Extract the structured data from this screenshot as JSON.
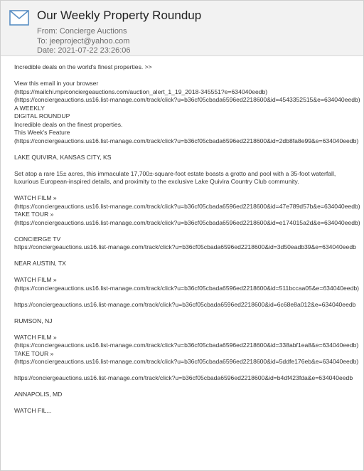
{
  "email": {
    "subject": "Our Weekly Property Roundup",
    "from": "From: Concierge Auctions",
    "to": "To: jeeproject@yahoo.com",
    "date": "Date: 2021-07-22 23:26:06"
  },
  "body": {
    "preheader": "Incredible deals on the world's finest properties. >>",
    "view_browser": "View this email in your browser",
    "view_url": "(https://mailchi.mp/conciergeauctions.com/auction_alert_1_19_2018-345551?e=634040eedb)",
    "track_url_1": "(https://conciergeauctions.us16.list-manage.com/track/click?u=b36cf05cbada6596ed2218600&id=4543352515&e=634040eedb)",
    "a_weekly": "A WEEKLY",
    "digital_roundup": "DIGITAL ROUNDUP",
    "tagline": "Incredible deals on the finest properties.",
    "feature_label": "This Week's Feature",
    "feature_url": "(https://conciergeauctions.us16.list-manage.com/track/click?u=b36cf05cbada6596ed2218600&id=2db8fa8e99&e=634040eedb)",
    "loc1": "LAKE QUIVIRA, KANSAS CITY, KS",
    "desc1": "Set atop a rare 15± acres, this immaculate 17,700±-square-foot estate boasts a grotto and pool with a 35-foot waterfall, luxurious European-inspired details, and proximity to the exclusive Lake Quivira Country Club community.",
    "watch1": "WATCH FILM »",
    "watch1_url": "(https://conciergeauctions.us16.list-manage.com/track/click?u=b36cf05cbada6596ed2218600&id=47e789d57b&e=634040eedb)",
    "tour1": "TAKE TOUR »",
    "tour1_url": "(https://conciergeauctions.us16.list-manage.com/track/click?u=b36cf05cbada6596ed2218600&id=e174015a2d&e=634040eedb)",
    "concierge_tv": "CONCIERGE TV",
    "tv_url": "https://conciergeauctions.us16.list-manage.com/track/click?u=b36cf05cbada6596ed2218600&id=3d50eadb39&e=634040eedb",
    "loc2": "NEAR AUSTIN, TX",
    "watch2": "WATCH FILM »",
    "watch2_url": "(https://conciergeauctions.us16.list-manage.com/track/click?u=b36cf05cbada6596ed2218600&id=511bccaa05&e=634040eedb)",
    "loc2_url": "https://conciergeauctions.us16.list-manage.com/track/click?u=b36cf05cbada6596ed2218600&id=6c68e8a012&e=634040eedb",
    "loc3": "RUMSON, NJ",
    "watch3": "WATCH FILM »",
    "watch3_url": "(https://conciergeauctions.us16.list-manage.com/track/click?u=b36cf05cbada6596ed2218600&id=338abf1ea8&e=634040eedb)",
    "tour3": "TAKE TOUR »",
    "tour3_url": "(https://conciergeauctions.us16.list-manage.com/track/click?u=b36cf05cbada6596ed2218600&id=5ddfe176eb&e=634040eedb)",
    "loc3_url": "https://conciergeauctions.us16.list-manage.com/track/click?u=b36cf05cbada6596ed2218600&id=b4df423fda&e=634040eedb",
    "loc4": "ANNAPOLIS, MD",
    "watch4_trunc": "WATCH FIL..."
  },
  "icons": {
    "header": "envelope-icon"
  },
  "colors": {
    "header_bg": "#f2f2f2",
    "icon": "#5a8fc4"
  }
}
